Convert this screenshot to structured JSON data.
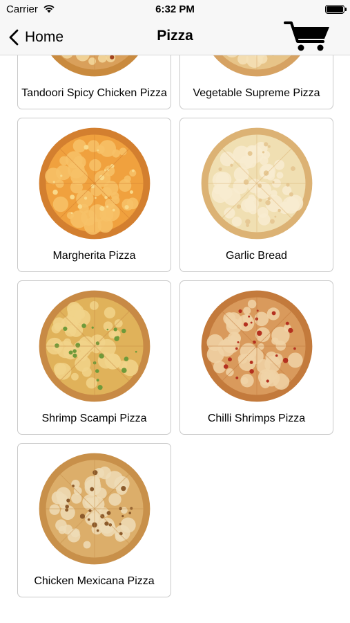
{
  "status_bar": {
    "carrier": "Carrier",
    "time": "6:32 PM"
  },
  "nav": {
    "back_label": "Home",
    "title": "Pizza",
    "cart_icon": "shopping-cart-icon"
  },
  "items": [
    {
      "name": "Tandoori Spicy Chicken Pizza",
      "sauce": "#d9a05b",
      "cheese": "#f3d9a0",
      "crust": "#c98a3e",
      "topping": "#a2431e"
    },
    {
      "name": "Vegetable Supreme Pizza",
      "sauce": "#e7c488",
      "cheese": "#f5e2b8",
      "crust": "#d6a262",
      "topping": "#3f3a2f"
    },
    {
      "name": "Margherita Pizza",
      "sauce": "#f0a13e",
      "cheese": "#f7c268",
      "crust": "#d37f2f",
      "topping": "#f9d98a"
    },
    {
      "name": "Garlic Bread",
      "sauce": "#f0dfb2",
      "cheese": "#f8ecd0",
      "crust": "#dcb274",
      "topping": "#e6c894"
    },
    {
      "name": "Shrimp Scampi Pizza",
      "sauce": "#e0b25a",
      "cheese": "#f1d48b",
      "crust": "#c88a45",
      "topping": "#6f9a3a"
    },
    {
      "name": "Chilli Shrimps Pizza",
      "sauce": "#d99a5c",
      "cheese": "#f0d3a7",
      "crust": "#c37a3c",
      "topping": "#b4301f"
    },
    {
      "name": "Chicken Mexicana Pizza",
      "sauce": "#dcae6a",
      "cheese": "#efdcb6",
      "crust": "#c8904a",
      "topping": "#8b5a2b"
    }
  ]
}
